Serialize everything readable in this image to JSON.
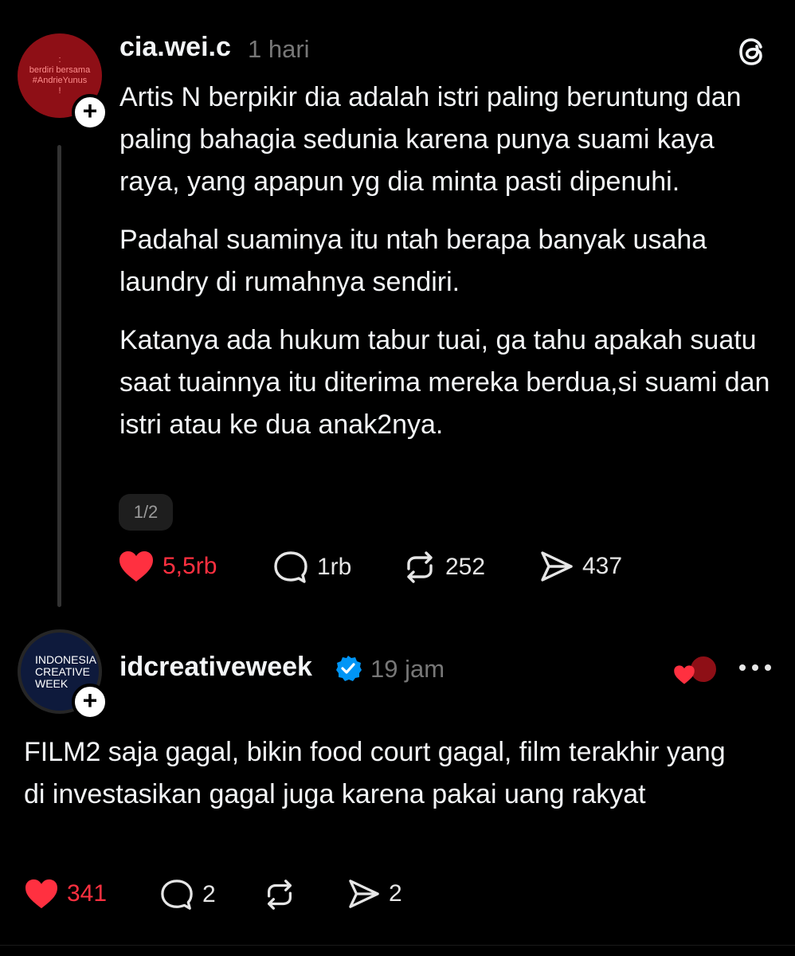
{
  "colors": {
    "background": "#000000",
    "text": "#f3f5f7",
    "muted": "#777777",
    "like": "#ff3040",
    "verified": "#0095f6"
  },
  "posts": [
    {
      "username": "cia.wei.c",
      "timestamp": "1 hari",
      "avatar_text": [
        ":",
        "berdiri bersama",
        "#AndrieYunus",
        "!"
      ],
      "paragraphs": [
        "Artis N berpikir dia adalah istri paling beruntung dan paling bahagia sedunia karena punya suami kaya raya, yang apapun yg dia minta pasti dipenuhi.",
        "Padahal suaminya itu ntah berapa banyak usaha laundry di rumahnya sendiri.",
        "Katanya ada hukum tabur tuai, ga tahu apakah suatu saat tuainnya itu diterima mereka berdua,si suami dan istri atau ke dua anak2nya."
      ],
      "page_indicator": "1/2",
      "likes": "5,5rb",
      "replies": "1rb",
      "reposts": "252",
      "shares": "437",
      "liked": true,
      "follow_label": "+"
    },
    {
      "username": "idcreativeweek",
      "verified": true,
      "timestamp": "19 jam",
      "avatar_text": [
        "INDONESIA",
        "CREATIVE",
        "WEEK"
      ],
      "body": "FILM2 saja gagal, bikin food court gagal, film terakhir yang di investasikan gagal juga karena pakai uang rakyat",
      "likes": "341",
      "replies": "2",
      "reposts": "",
      "shares": "2",
      "liked": true,
      "follow_label": "+"
    }
  ],
  "icons": [
    "threads-logo-icon",
    "heart-icon",
    "comment-icon",
    "repost-icon",
    "share-icon",
    "verified-badge-icon",
    "more-icon",
    "plus-icon"
  ]
}
